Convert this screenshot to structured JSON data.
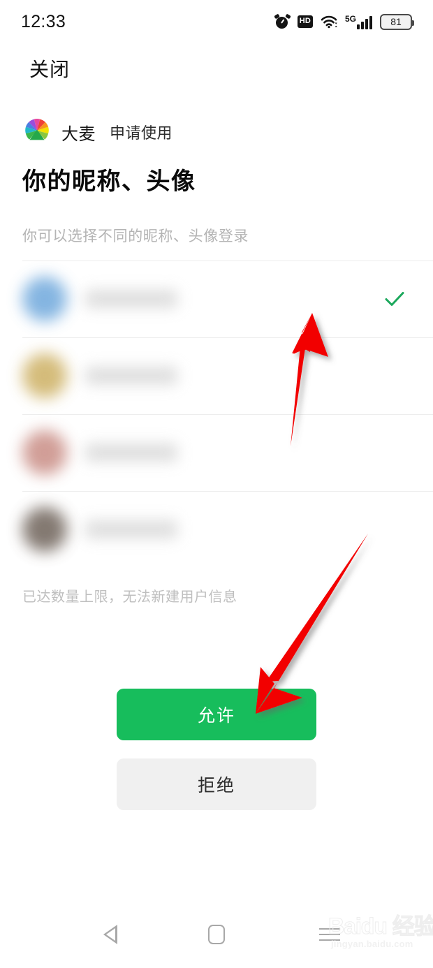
{
  "status_bar": {
    "time": "12:33",
    "icons": [
      {
        "name": "alarm-icon",
        "label": "alarm"
      },
      {
        "name": "hd-icon",
        "label": "HD"
      },
      {
        "name": "wifi-icon",
        "label": "wifi"
      },
      {
        "name": "signal-5g-icon",
        "label": "5G"
      },
      {
        "name": "battery-icon",
        "label": "81"
      }
    ],
    "hd_label": "HD",
    "network_label": "5G",
    "battery_level": "81"
  },
  "header": {
    "close_label": "关闭"
  },
  "permission": {
    "app_name": "大麦",
    "app_action": "申请使用",
    "title": "你的昵称、头像",
    "subtitle": "你可以选择不同的昵称、头像登录",
    "limit_note": "已达数量上限，无法新建用户信息",
    "allow_label": "允许",
    "reject_label": "拒绝",
    "accent_color": "#17bd5c",
    "check_color": "#1ba85c"
  },
  "accounts": [
    {
      "avatar_color": "#6fa8dc",
      "nickname": "",
      "selected": true
    },
    {
      "avatar_color": "#cdb063",
      "nickname": "",
      "selected": false
    },
    {
      "avatar_color": "#c98d85",
      "nickname": "",
      "selected": false
    },
    {
      "avatar_color": "#6e6259",
      "nickname": "",
      "selected": false
    }
  ],
  "annotations": {
    "arrow_color": "#f00000",
    "arrows": [
      {
        "name": "arrow-to-checkmark",
        "target": "selected-account-check"
      },
      {
        "name": "arrow-to-allow-button",
        "target": "allow-button"
      }
    ]
  },
  "nav_bar": {
    "back_label": "back",
    "home_label": "home",
    "recents_label": "recents"
  },
  "watermark": {
    "brand": "Baidu 经验",
    "url": "jingyan.baidu.com"
  }
}
